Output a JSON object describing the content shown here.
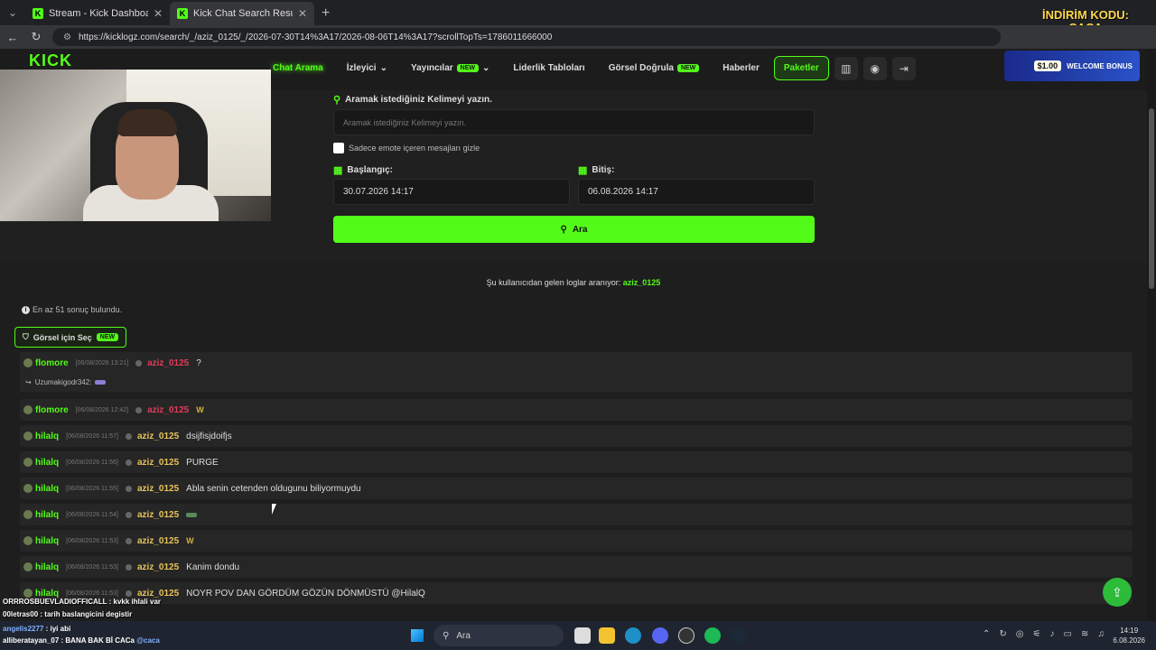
{
  "browser": {
    "tabs": [
      {
        "label": "Stream - Kick Dashboard",
        "active": false
      },
      {
        "label": "Kick Chat Search Results",
        "active": true
      }
    ],
    "url": "https://kicklogz.com/search/_/aziz_0125/_/2026-07-30T14%3A17/2026-08-06T14%3A17?scrollTopTs=1786011666000"
  },
  "promo": {
    "line1": "İNDİRİM KODU:",
    "line2": "ÇAÇA"
  },
  "site": {
    "logo": "KICK",
    "nav": {
      "chat_arama": "Chat Arama",
      "izleyici": "İzleyici",
      "yayincilar": "Yayıncılar",
      "liderlik": "Liderlik Tabloları",
      "gorsel_dogrula": "Görsel Doğrula",
      "haberler": "Haberler",
      "paketler": "Paketler",
      "new_badge": "NEW"
    },
    "ad": {
      "amount": "$1.00",
      "text": "WELCOME BONUS"
    }
  },
  "search": {
    "keyword_label": "Aramak istediğiniz Kelimeyi yazın.",
    "keyword_placeholder": "Aramak istediğiniz Kelimeyi yazın.",
    "emote_filter_label": "Sadece emote içeren mesajları gizle",
    "start_label": "Başlangıç:",
    "start_value": "30.07.2026 14:17",
    "end_label": "Bitiş:",
    "end_value": "06.08.2026 14:17",
    "button_label": "Ara"
  },
  "results": {
    "query_prefix": "Şu kullanıcıdan gelen loglar aranıyor:",
    "query_user": "aziz_0125",
    "count_text": "En az 51 sonuç bulundu.",
    "select_visual_label": "Görsel için Seç",
    "select_visual_badge": "NEW",
    "reply_user": "Uzumakigodr342:",
    "messages": [
      {
        "channel": "flomore",
        "time": "[06/08/2026 13:21]",
        "user": "aziz_0125",
        "text": "?"
      },
      {
        "channel": "flomore",
        "time": "[06/08/2026 12:42]",
        "user": "aziz_0125",
        "text": "W"
      },
      {
        "channel": "hilalq",
        "time": "[06/08/2026 11:57]",
        "user": "aziz_0125",
        "text": "dsijfisjdoifjs"
      },
      {
        "channel": "hilalq",
        "time": "[06/08/2026 11:56]",
        "user": "aziz_0125",
        "text": "PURGE"
      },
      {
        "channel": "hilalq",
        "time": "[06/08/2026 11:55]",
        "user": "aziz_0125",
        "text": "Abla senin cetenden oldugunu biliyormuydu"
      },
      {
        "channel": "hilalq",
        "time": "[06/08/2026 11:54]",
        "user": "aziz_0125",
        "text": ""
      },
      {
        "channel": "hilalq",
        "time": "[06/08/2026 11:53]",
        "user": "aziz_0125",
        "text": "W"
      },
      {
        "channel": "hilalq",
        "time": "[06/08/2026 11:53]",
        "user": "aziz_0125",
        "text": "Kanim dondu"
      },
      {
        "channel": "hilalq",
        "time": "[06/08/2026 11:53]",
        "user": "aziz_0125",
        "text": "NOYR POV DAN GÖRDÜM GÖZÜN DÖNMÜSTÜ @HilalQ"
      }
    ]
  },
  "stream_chat": [
    {
      "user": "ORRROSBUEVLADIOFFICALL",
      "text": ": kvkk ihlali var"
    },
    {
      "user": "00letras00",
      "text": ": tarih baslangicini degistir"
    },
    {
      "user": "angelis2277",
      "text": ": iyi abi"
    },
    {
      "user": "alliberatayan_07",
      "text": ": BANA BAK Bİ CACa",
      "mention": "@caca"
    }
  ],
  "taskbar": {
    "search": "Ara",
    "time": "14:19",
    "date": "6.08.2026"
  }
}
